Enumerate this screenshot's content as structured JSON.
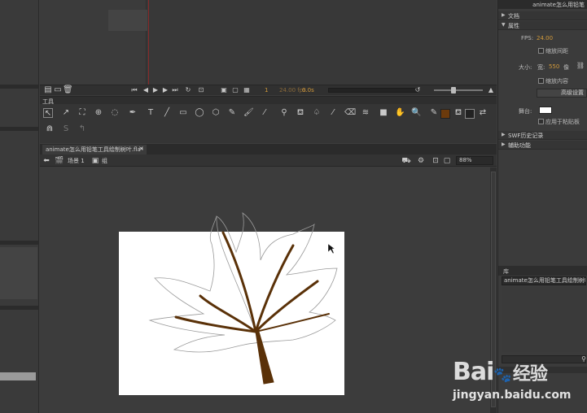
{
  "app": {
    "file_title": "animate怎么用铅笔"
  },
  "timeline": {
    "current_frame": "1",
    "fps": "24.00 fps",
    "time": "0.0s"
  },
  "tools": {
    "title": "工具",
    "items": [
      "selection-tool-icon",
      "subselection-tool-icon",
      "free-transform-tool-icon",
      "3d-rotation-tool-icon",
      "lasso-tool-icon",
      "pen-tool-icon",
      "text-tool-icon",
      "line-tool-icon",
      "rectangle-tool-icon",
      "oval-tool-icon",
      "polystar-tool-icon",
      "pencil-tool-icon",
      "brush-tool-icon",
      "paint-brush-tool-icon",
      "bone-tool-icon",
      "paint-bucket-tool-icon",
      "ink-bottle-tool-icon",
      "eyedropper-tool-icon",
      "eraser-tool-icon",
      "width-tool-icon",
      "camera-tool-icon",
      "hand-tool-icon",
      "zoom-tool-icon"
    ]
  },
  "document": {
    "tab_label": "animate怎么用铅笔工具绘制树叶.fla*",
    "scene_label": "场景 1",
    "group_label": "组",
    "zoom": "88%"
  },
  "right_panel": {
    "sections": {
      "document": "文档",
      "properties": "属性",
      "publish": "SWF历史记录",
      "stage_settings": "辅助功能"
    },
    "fps_label": "FPS:",
    "fps_value": "24.00",
    "scale_spans_label": "缩放间距",
    "size_label": "大小:",
    "width_prefix": "宽:",
    "width_value": "550",
    "height_prefix": "像",
    "scale_content_label": "缩放内容",
    "advanced_button": "高级设置",
    "stage_label": "舞台:",
    "apply_to_pasteboard": "应用于粘贴板",
    "library_tab": "库",
    "library_select": "animate怎么用铅笔工具绘制树叶"
  },
  "watermark": {
    "brand": "Bai",
    "brand_cn": "经验",
    "url": "jingyan.baidu.com"
  },
  "colors": {
    "stroke": "#000000",
    "fill": "#6b3a0c",
    "leaf_vein": "#5a3108"
  }
}
